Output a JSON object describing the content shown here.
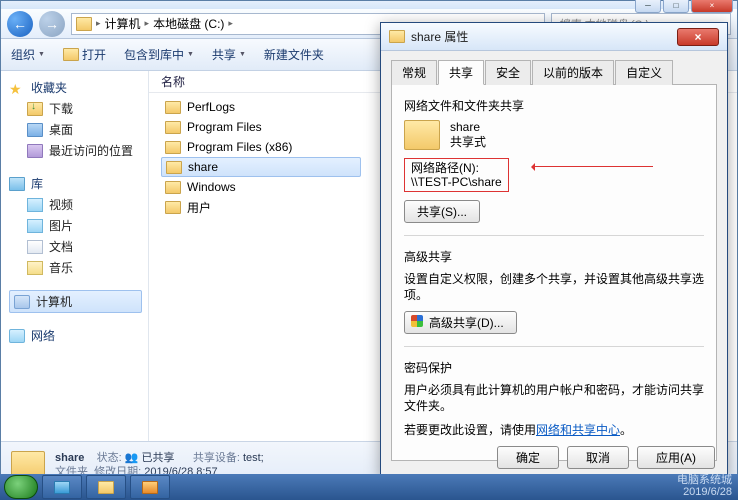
{
  "window": {
    "min": "─",
    "max": "□",
    "close": "×"
  },
  "nav": {
    "back": "←",
    "fwd": "→"
  },
  "breadcrumb": {
    "computer": "计算机",
    "drive": "本地磁盘 (C:)"
  },
  "search": {
    "placeholder": "搜索 本地磁盘 (C:)"
  },
  "toolbar": {
    "organize": "组织",
    "open": "打开",
    "include": "包含到库中",
    "share": "共享",
    "newfolder": "新建文件夹"
  },
  "sidebar": {
    "favorites": "收藏夹",
    "downloads": "下载",
    "desktop": "桌面",
    "recent": "最近访问的位置",
    "libraries": "库",
    "videos": "视频",
    "pictures": "图片",
    "documents": "文档",
    "music": "音乐",
    "computer": "计算机",
    "network": "网络"
  },
  "content": {
    "col_name": "名称",
    "files": {
      "perflogs": "PerfLogs",
      "progfiles": "Program Files",
      "progfilesx86": "Program Files (x86)",
      "share": "share",
      "windows": "Windows",
      "users": "用户"
    }
  },
  "details": {
    "name": "share",
    "type": "文件夹",
    "state_lab": "状态:",
    "state_val": "已共享",
    "mod_lab": "修改日期:",
    "mod_val": "2019/6/28 8:57",
    "dev_lab": "共享设备:",
    "dev_val": "test; "
  },
  "dialog": {
    "title": "share 属性",
    "close": "×",
    "tabs": {
      "general": "常规",
      "sharing": "共享",
      "security": "安全",
      "prev": "以前的版本",
      "custom": "自定义"
    },
    "section1": "网络文件和文件夹共享",
    "sharename": "share",
    "sharetype": "共享式",
    "netpath_lab": "网络路径(N):",
    "netpath_val": "\\\\TEST-PC\\share",
    "share_btn": "共享(S)...",
    "adv_title": "高级共享",
    "adv_desc": "设置自定义权限，创建多个共享，并设置其他高级共享选项。",
    "adv_btn": "高级共享(D)...",
    "pw_title": "密码保护",
    "pw_desc1": "用户必须具有此计算机的用户帐户和密码，才能访问共享文件夹。",
    "pw_desc2a": "若要更改此设置，请使用",
    "pw_link": "网络和共享中心",
    "pw_desc2b": "。",
    "ok": "确定",
    "cancel": "取消",
    "apply": "应用(A)"
  },
  "watermark": {
    "line1": "电脑系统城",
    "line2": "2019/6/28"
  }
}
